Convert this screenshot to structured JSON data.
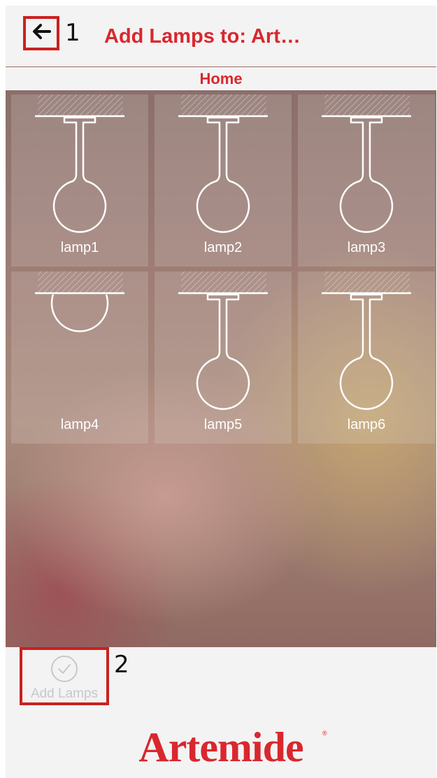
{
  "header": {
    "title": "Add Lamps to: Art…",
    "back_annotation": "1"
  },
  "room": {
    "label": "Home"
  },
  "lamps": [
    {
      "label": "lamp1",
      "type": "pendant"
    },
    {
      "label": "lamp2",
      "type": "pendant"
    },
    {
      "label": "lamp3",
      "type": "pendant"
    },
    {
      "label": "lamp4",
      "type": "ceiling"
    },
    {
      "label": "lamp5",
      "type": "pendant"
    },
    {
      "label": "lamp6",
      "type": "pendant"
    }
  ],
  "footer": {
    "add_label": "Add Lamps",
    "add_annotation": "2",
    "brand": "Artemide",
    "brand_mark": "®"
  },
  "colors": {
    "accent": "#d9272e",
    "annotation_box": "#cc1f1f"
  },
  "icons": {
    "back": "arrow-left-icon",
    "add": "check-circle-icon",
    "lamp": "pendant-lamp-icon"
  }
}
